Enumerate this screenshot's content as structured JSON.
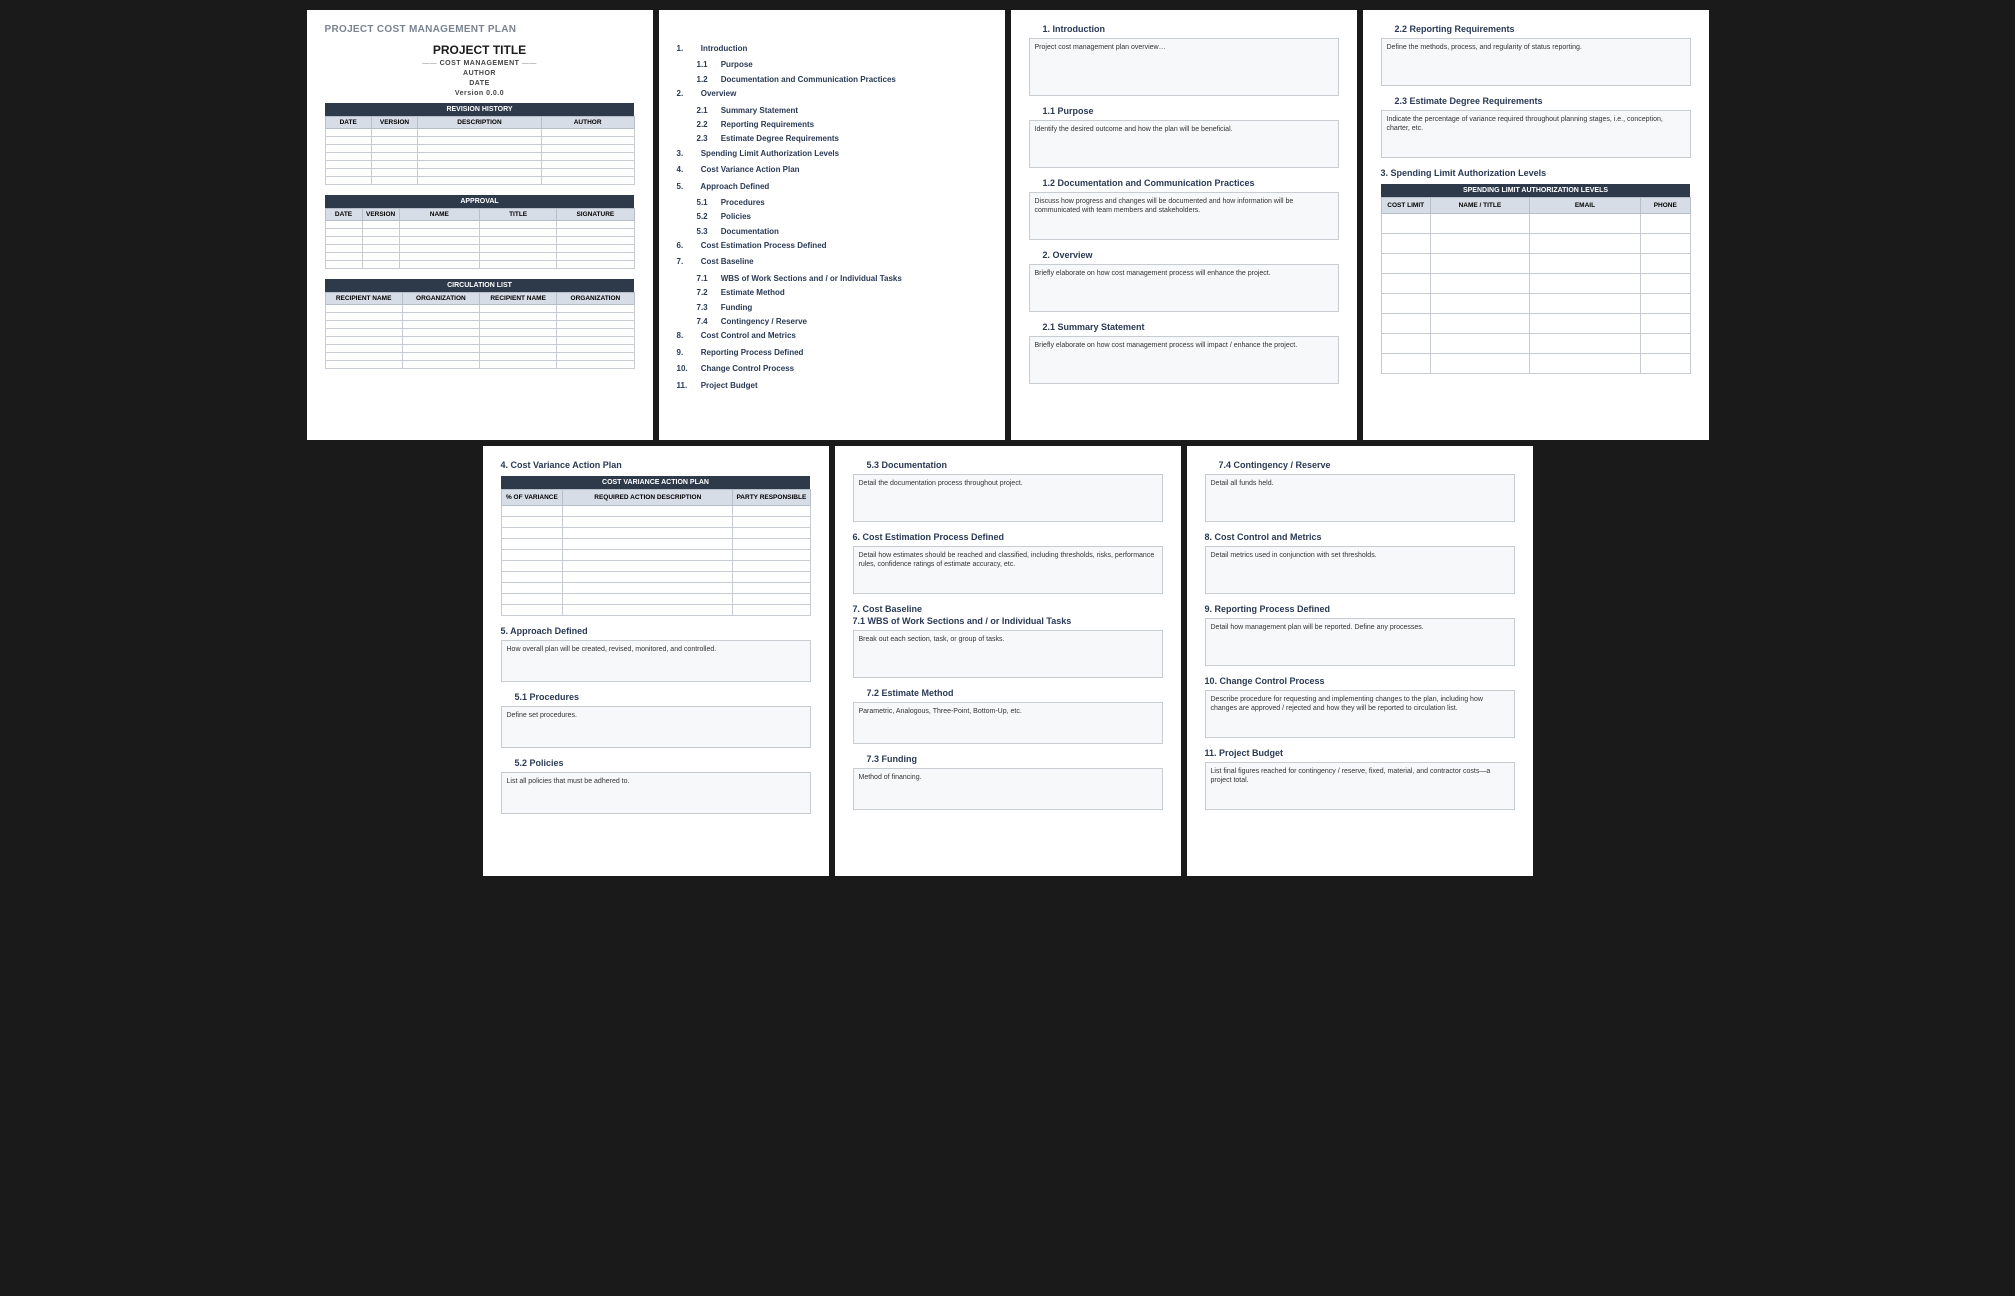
{
  "docTitle": "PROJECT COST MANAGEMENT PLAN",
  "cover": {
    "projectTitle": "PROJECT TITLE",
    "subtitle": "COST MANAGEMENT",
    "author": "AUTHOR",
    "date": "DATE",
    "version": "Version 0.0.0",
    "revisionHistory": {
      "title": "REVISION HISTORY",
      "headers": [
        "DATE",
        "VERSION",
        "DESCRIPTION",
        "AUTHOR"
      ]
    },
    "approval": {
      "title": "APPROVAL",
      "headers": [
        "DATE",
        "VERSION",
        "NAME",
        "TITLE",
        "SIGNATURE"
      ]
    },
    "circulation": {
      "title": "CIRCULATION LIST",
      "headers": [
        "RECIPIENT NAME",
        "ORGANIZATION",
        "RECIPIENT NAME",
        "ORGANIZATION"
      ]
    }
  },
  "toc": [
    {
      "n": "1.",
      "t": "Introduction",
      "sub": [
        {
          "n": "1.1",
          "t": "Purpose"
        },
        {
          "n": "1.2",
          "t": "Documentation and Communication Practices"
        }
      ]
    },
    {
      "n": "2.",
      "t": "Overview",
      "sub": [
        {
          "n": "2.1",
          "t": "Summary Statement"
        },
        {
          "n": "2.2",
          "t": "Reporting Requirements"
        },
        {
          "n": "2.3",
          "t": "Estimate Degree Requirements"
        }
      ]
    },
    {
      "n": "3.",
      "t": "Spending Limit Authorization Levels"
    },
    {
      "n": "4.",
      "t": "Cost Variance Action Plan"
    },
    {
      "n": "5.",
      "t": "Approach Defined",
      "sub": [
        {
          "n": "5.1",
          "t": "Procedures"
        },
        {
          "n": "5.2",
          "t": "Policies"
        },
        {
          "n": "5.3",
          "t": "Documentation"
        }
      ]
    },
    {
      "n": "6.",
      "t": "Cost Estimation Process Defined"
    },
    {
      "n": "7.",
      "t": "Cost Baseline",
      "sub": [
        {
          "n": "7.1",
          "t": "WBS of Work Sections and / or Individual Tasks"
        },
        {
          "n": "7.2",
          "t": "Estimate Method"
        },
        {
          "n": "7.3",
          "t": "Funding"
        },
        {
          "n": "7.4",
          "t": "Contingency / Reserve"
        }
      ]
    },
    {
      "n": "8.",
      "t": "Cost Control and Metrics"
    },
    {
      "n": "9.",
      "t": "Reporting Process Defined"
    },
    {
      "n": "10.",
      "t": "Change Control Process"
    },
    {
      "n": "11.",
      "t": "Project Budget"
    }
  ],
  "p3": {
    "s1": {
      "h": "1. Introduction",
      "t": "Project cost management plan overview…"
    },
    "s1_1": {
      "h": "1.1   Purpose",
      "t": "Identify the desired outcome and how the plan will be beneficial."
    },
    "s1_2": {
      "h": "1.2   Documentation and Communication Practices",
      "t": "Discuss how progress and changes will be documented and how information will be communicated with team members and stakeholders."
    },
    "s2": {
      "h": "2. Overview",
      "t": "Briefly elaborate on how cost management process will enhance the project."
    },
    "s2_1": {
      "h": "2.1   Summary Statement",
      "t": "Briefly elaborate on how cost management process will impact / enhance the project."
    }
  },
  "p4": {
    "s2_2": {
      "h": "2.2   Reporting Requirements",
      "t": "Define the methods, process, and regularity of status reporting."
    },
    "s2_3": {
      "h": "2.3   Estimate Degree Requirements",
      "t": "Indicate the percentage of variance required throughout planning stages, i.e., conception, charter, etc."
    },
    "s3": {
      "h": "3. Spending Limit Authorization Levels",
      "tableTitle": "SPENDING LIMIT AUTHORIZATION LEVELS",
      "headers": [
        "COST LIMIT",
        "NAME / TITLE",
        "EMAIL",
        "PHONE"
      ]
    }
  },
  "p5": {
    "s4": {
      "h": "4. Cost Variance Action Plan",
      "tableTitle": "COST VARIANCE ACTION PLAN",
      "headers": [
        "% OF VARIANCE",
        "REQUIRED ACTION DESCRIPTION",
        "PARTY RESPONSIBLE"
      ]
    },
    "s5": {
      "h": "5. Approach Defined",
      "t": "How overall plan will be created, revised, monitored, and controlled."
    },
    "s5_1": {
      "h": "5.1   Procedures",
      "t": "Define set procedures."
    },
    "s5_2": {
      "h": "5.2   Policies",
      "t": "List all policies that must be adhered to."
    }
  },
  "p6": {
    "s5_3": {
      "h": "5.3   Documentation",
      "t": "Detail the documentation process throughout project."
    },
    "s6": {
      "h": "6. Cost Estimation Process Defined",
      "t": "Detail how estimates should be reached and classified, including thresholds, risks, performance rules, confidence ratings of estimate accuracy, etc."
    },
    "s7": {
      "h": "7. Cost Baseline"
    },
    "s7_1": {
      "h": "7.1   WBS of Work Sections and / or Individual Tasks",
      "t": "Break out each section, task, or group of tasks."
    },
    "s7_2": {
      "h": "7.2   Estimate Method",
      "t": "Parametric, Analogous, Three-Point, Bottom-Up, etc."
    },
    "s7_3": {
      "h": "7.3   Funding",
      "t": "Method of financing."
    }
  },
  "p7": {
    "s7_4": {
      "h": "7.4   Contingency / Reserve",
      "t": "Detail all funds held."
    },
    "s8": {
      "h": "8. Cost Control and Metrics",
      "t": "Detail metrics used in conjunction with set thresholds."
    },
    "s9": {
      "h": "9. Reporting Process Defined",
      "t": "Detail how management plan will be reported. Define any processes."
    },
    "s10": {
      "h": "10. Change Control Process",
      "t": "Describe procedure for requesting and implementing changes to the plan, including how changes are approved / rejected and how they will be reported to circulation list."
    },
    "s11": {
      "h": "11. Project Budget",
      "t": "List final figures reached for contingency / reserve, fixed, material, and contractor costs—a project total."
    }
  }
}
